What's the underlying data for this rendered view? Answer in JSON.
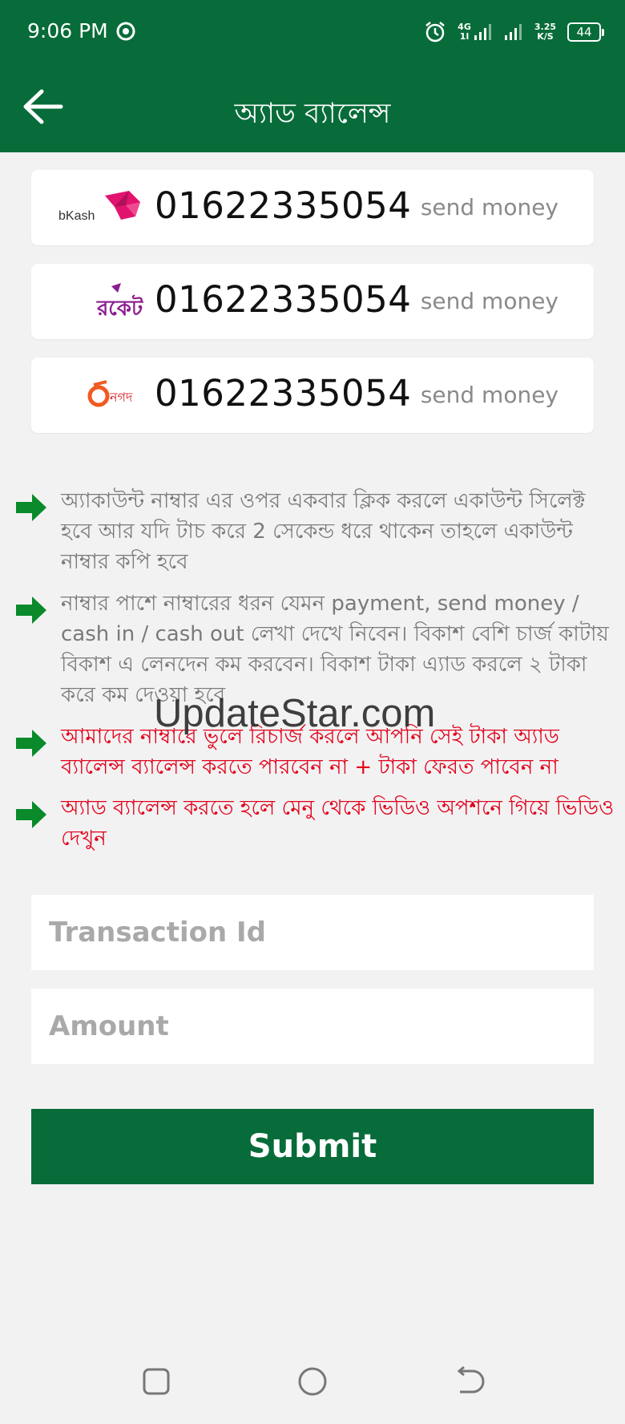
{
  "status_bar": {
    "time": "9:06 PM",
    "network": "4G",
    "network_sub": "1l",
    "speed_value": "3.25",
    "speed_unit": "K/S",
    "battery": "44"
  },
  "app_bar": {
    "title": "অ্যাড ব্যালেন্স"
  },
  "payment_methods": [
    {
      "logo": "bkash-logo",
      "logo_text": "bKash",
      "number": "01622335054",
      "type": "send money"
    },
    {
      "logo": "rocket-logo",
      "logo_text": "রকেট",
      "number": "01622335054",
      "type": "send money"
    },
    {
      "logo": "nagad-logo",
      "logo_text": "নগদ",
      "number": "01622335054",
      "type": "send money"
    }
  ],
  "notes": [
    {
      "text": "অ্যাকাউন্ট নাম্বার এর ওপর একবার ক্লিক করলে একাউন্ট সিলেক্ট হবে আর যদি টাচ করে 2 সেকেন্ড ধরে থাকেন তাহলে একাউন্ট নাম্বার কপি হবে",
      "color": "gray"
    },
    {
      "text": "নাম্বার পাশে নাম্বারের ধরন যেমন payment, send money / cash in / cash out লেখা দেখে নিবেন। বিকাশ বেশি চার্জ কাটায় বিকাশ এ লেনদেন কম করবেন। বিকাশ টাকা এ্যাড করলে ২ টাকা করে কম দেওয়া হবে",
      "color": "gray"
    },
    {
      "text": "আমাদের নাম্বারে ভুলে রিচার্জ করলে আপনি সেই টাকা অ্যাড ব্যালেন্স ব্যালেন্স করতে পারবেন না + টাকা ফেরত পাবেন না",
      "color": "red"
    },
    {
      "text": "অ্যাড ব্যালেন্স করতে হলে মেনু থেকে ভিডিও অপশনে গিয়ে ভিডিও দেখুন",
      "color": "red"
    }
  ],
  "watermark": "UpdateStar.com",
  "form": {
    "transaction_placeholder": "Transaction Id",
    "amount_placeholder": "Amount",
    "submit_label": "Submit"
  },
  "colors": {
    "primary": "#076c39",
    "note_gray": "#7a7a7a",
    "note_red": "#e3001b",
    "arrow_green": "#0a8a2a",
    "bkash_pink": "#e2136e",
    "rocket_purple": "#8b1d8f",
    "nagad_orange": "#f15a22",
    "nagad_red": "#d71920"
  }
}
